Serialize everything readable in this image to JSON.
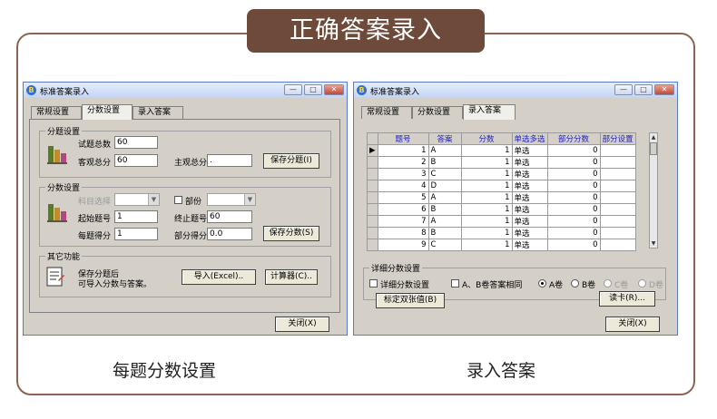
{
  "banner": {
    "title": "正确答案录入"
  },
  "captions": {
    "left": "每题分数设置",
    "right": "录入答案"
  },
  "dialog_title": "标准答案录入",
  "tabs": [
    "常规设置",
    "分数设置",
    "录入答案"
  ],
  "left": {
    "active_tab": "分数设置",
    "group_topic": {
      "title": "分题设置",
      "total_label": "试题总数",
      "total_value": "60",
      "objective_label": "客观总分",
      "objective_value": "60",
      "subjective_label": "主观总分",
      "subjective_value": ".",
      "save_button": "保存分题(I)"
    },
    "group_score": {
      "title": "分数设置",
      "subject_label": "科目选择",
      "subject_value": "",
      "part_label": "部份",
      "part_value": "",
      "start_label": "起始题号",
      "start_value": "1",
      "end_label": "终止题号",
      "end_value": "60",
      "each_label": "每题得分",
      "each_value": "1",
      "partial_label": "部分得分",
      "partial_value": "0.0",
      "save_button": "保存分数(S)"
    },
    "group_other": {
      "title": "其它功能",
      "note_line1": "保存分题后",
      "note_line2": "可导入分数与答案。",
      "import_button": "导入(Excel)..",
      "calc_button": "计算器(C).."
    },
    "close_button": "关闭(X)"
  },
  "right": {
    "active_tab": "录入答案",
    "grid": {
      "headers": [
        "题号",
        "答案",
        "分数",
        "单选多选",
        "部分分数",
        "部分设置"
      ],
      "rows": [
        {
          "no": "1",
          "ans": "A",
          "score": "1",
          "type": "单选",
          "partial": "0",
          "setting": ""
        },
        {
          "no": "2",
          "ans": "B",
          "score": "1",
          "type": "单选",
          "partial": "0",
          "setting": ""
        },
        {
          "no": "3",
          "ans": "C",
          "score": "1",
          "type": "单选",
          "partial": "0",
          "setting": ""
        },
        {
          "no": "4",
          "ans": "D",
          "score": "1",
          "type": "单选",
          "partial": "0",
          "setting": ""
        },
        {
          "no": "5",
          "ans": "A",
          "score": "1",
          "type": "单选",
          "partial": "0",
          "setting": ""
        },
        {
          "no": "6",
          "ans": "B",
          "score": "1",
          "type": "单选",
          "partial": "0",
          "setting": ""
        },
        {
          "no": "7",
          "ans": "A",
          "score": "1",
          "type": "单选",
          "partial": "0",
          "setting": ""
        },
        {
          "no": "8",
          "ans": "B",
          "score": "1",
          "type": "单选",
          "partial": "0",
          "setting": ""
        },
        {
          "no": "9",
          "ans": "C",
          "score": "1",
          "type": "单选",
          "partial": "0",
          "setting": ""
        }
      ]
    },
    "detail": {
      "title": "详细分数设置",
      "detail_check": "详细分数设置",
      "ab_check": "A、B卷答案相同",
      "radios": [
        "A卷",
        "B卷",
        "C卷",
        "D卷"
      ],
      "selected_radio": "A卷",
      "fixed_button": "标定双张值(B)",
      "read_button": "读卡(R)..."
    },
    "close_button": "关闭(X)"
  }
}
